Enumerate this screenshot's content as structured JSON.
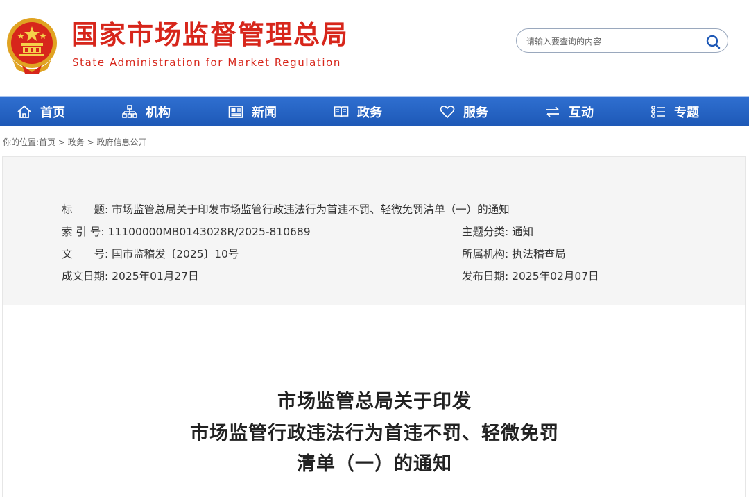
{
  "header": {
    "site_title": "国家市场监督管理总局",
    "site_subtitle": "State Administration for Market Regulation",
    "search_placeholder": "请输入要查询的内容"
  },
  "nav": [
    {
      "label": "首页",
      "icon": "home-icon"
    },
    {
      "label": "机构",
      "icon": "org-chart-icon"
    },
    {
      "label": "新闻",
      "icon": "newspaper-icon"
    },
    {
      "label": "政务",
      "icon": "book-icon"
    },
    {
      "label": "服务",
      "icon": "heart-icon"
    },
    {
      "label": "互动",
      "icon": "exchange-icon"
    },
    {
      "label": "专题",
      "icon": "list-icon"
    }
  ],
  "breadcrumb": {
    "prefix": "你的位置:",
    "items": [
      "首页",
      "政务",
      "政府信息公开"
    ],
    "separator": ">"
  },
  "info": {
    "title_label": "标　　题:",
    "title_value": "市场监管总局关于印发市场监管行政违法行为首违不罚、轻微免罚清单（一）的通知",
    "index_label": "索 引 号:",
    "index_value": "11100000MB0143028R/2025-810689",
    "topic_label": "主题分类:",
    "topic_value": "通知",
    "docno_label": "文　　号:",
    "docno_value": "国市监稽发〔2025〕10号",
    "org_label": "所属机构:",
    "org_value": "执法稽查局",
    "created_label": "成文日期:",
    "created_value": "2025年01月27日",
    "published_label": "发布日期:",
    "published_value": "2025年02月07日"
  },
  "document": {
    "title_line1": "市场监管总局关于印发",
    "title_line2": "市场监管行政违法行为首违不罚、轻微免罚",
    "title_line3": "清单（一）的通知"
  },
  "colors": {
    "brand_red": "#d7261b",
    "nav_blue": "#1d58b6",
    "info_bg": "#f5f5f5"
  }
}
